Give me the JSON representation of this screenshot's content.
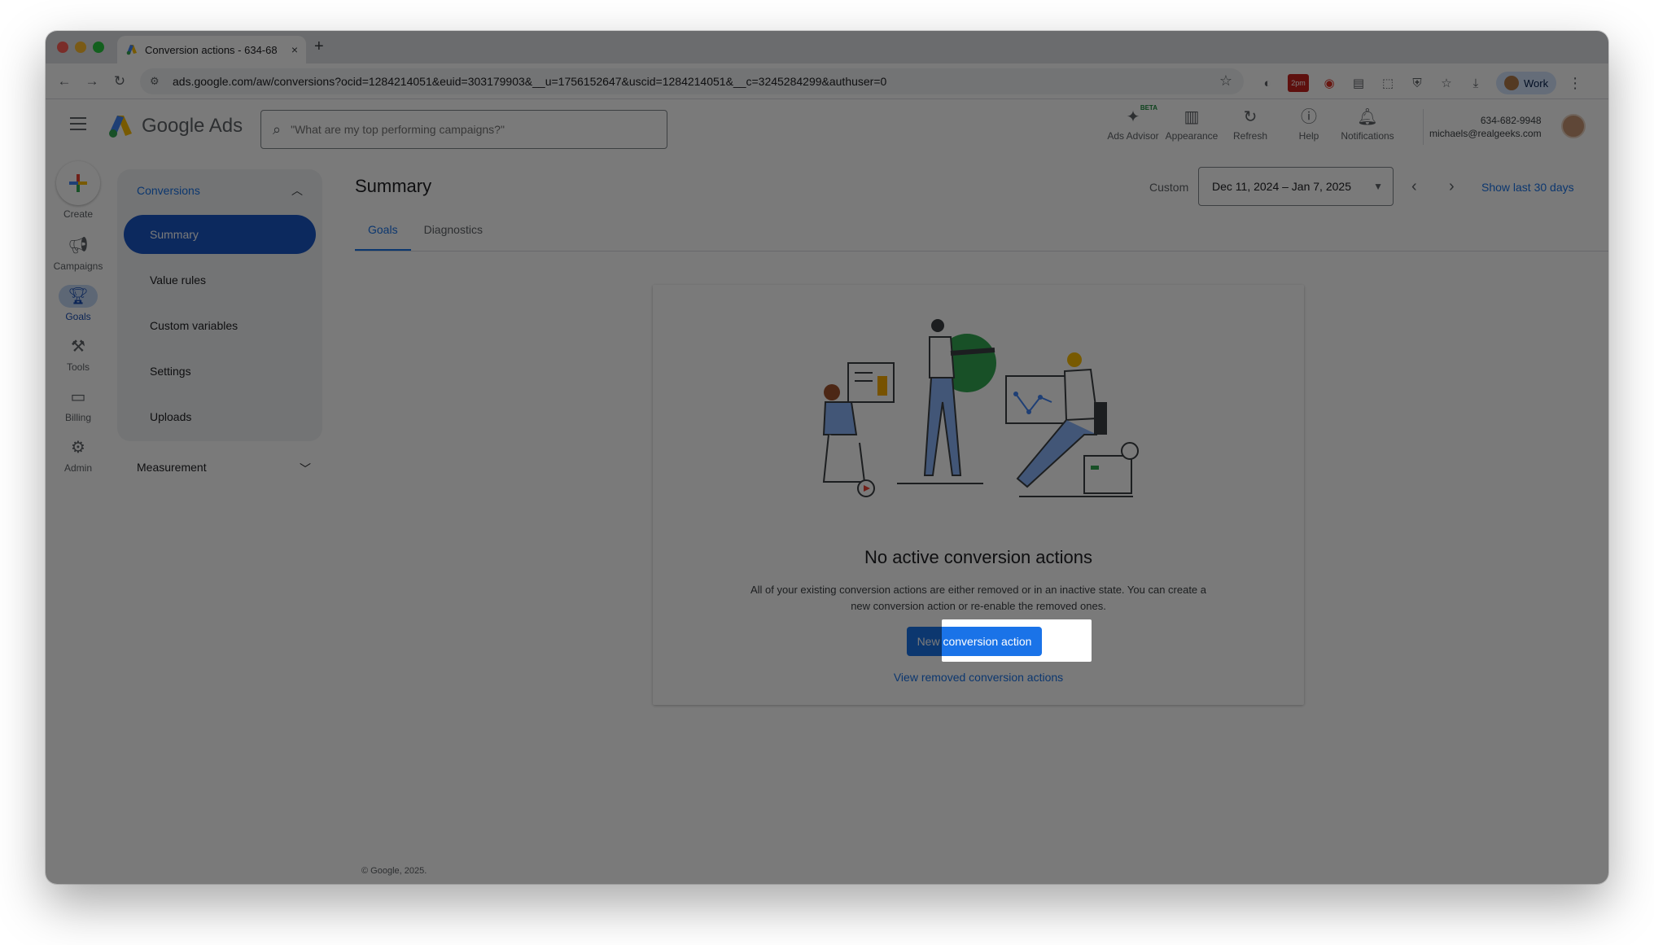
{
  "browser": {
    "tab_title": "Conversion actions - 634-68",
    "tab_close": "×",
    "new_tab": "+",
    "url": "ads.google.com/aw/conversions?ocid=1284214051&euid=303179903&__u=1756152647&uscid=1284214051&__c=3245284299&authuser=0",
    "calendar_badge": "2pm",
    "profile_label": "Work"
  },
  "header": {
    "product_name": "Google Ads",
    "search_placeholder": "\"What are my top performing campaigns?\"",
    "actions": [
      {
        "label": "Ads Advisor",
        "icon": "sparkle-icon",
        "badge": "BETA"
      },
      {
        "label": "Appearance",
        "icon": "appearance-icon"
      },
      {
        "label": "Refresh",
        "icon": "refresh-icon"
      },
      {
        "label": "Help",
        "icon": "help-icon"
      },
      {
        "label": "Notifications",
        "icon": "bell-icon"
      }
    ],
    "account_phone": "634-682-9948",
    "account_email": "michaels@realgeeks.com"
  },
  "rail": {
    "items": [
      {
        "label": "Create",
        "icon": "plus-icon"
      },
      {
        "label": "Campaigns",
        "icon": "megaphone-icon"
      },
      {
        "label": "Goals",
        "icon": "trophy-icon",
        "active": true
      },
      {
        "label": "Tools",
        "icon": "tools-icon"
      },
      {
        "label": "Billing",
        "icon": "card-icon"
      },
      {
        "label": "Admin",
        "icon": "gear-icon"
      }
    ]
  },
  "sidenav": {
    "section_label": "Conversions",
    "items": [
      {
        "label": "Summary",
        "active": true
      },
      {
        "label": "Value rules"
      },
      {
        "label": "Custom variables"
      },
      {
        "label": "Settings"
      },
      {
        "label": "Uploads"
      }
    ],
    "measurement_label": "Measurement"
  },
  "main": {
    "title": "Summary",
    "date_mode": "Custom",
    "date_range": "Dec 11, 2024 – Jan 7, 2025",
    "show_last": "Show last 30 days",
    "tabs": [
      "Goals",
      "Diagnostics"
    ]
  },
  "card": {
    "title": "No active conversion actions",
    "body_line1": "All of your existing conversion actions are either removed or in an inactive state. You can create a",
    "body_line2": "new conversion action or re-enable the removed ones.",
    "primary_button": "New conversion action",
    "link": "View removed conversion actions"
  },
  "footer": {
    "copyright": "© Google, 2025."
  },
  "colors": {
    "accent": "#1a73e8",
    "active_nav": "#1a56c4",
    "dim_overlay": "rgba(0,0,0,0.52)"
  }
}
